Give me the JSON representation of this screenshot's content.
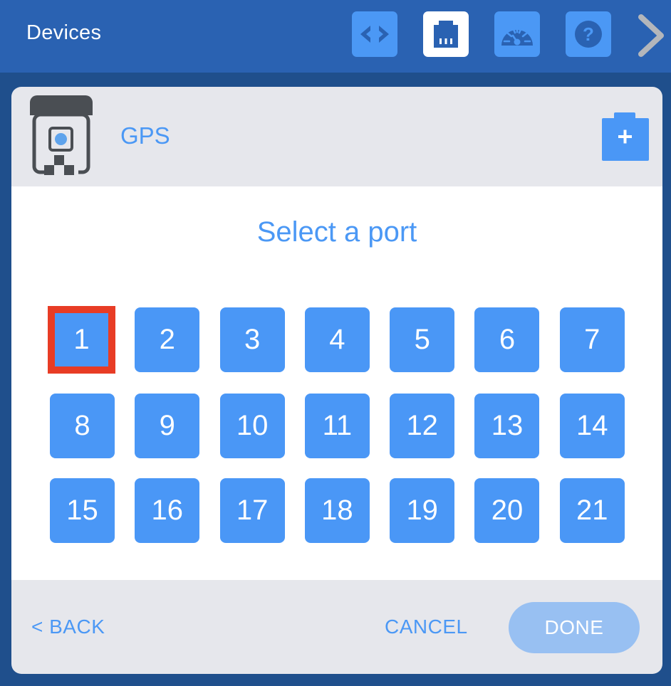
{
  "topbar": {
    "title": "Devices",
    "buttons": [
      {
        "icon": "code-icon",
        "label": "Code",
        "active": false
      },
      {
        "icon": "ports-icon",
        "label": "Devices",
        "active": true
      },
      {
        "icon": "dashboard-icon",
        "label": "Dashboard",
        "active": false
      },
      {
        "icon": "help-icon",
        "label": "Help",
        "active": false
      }
    ],
    "next_icon": "chevron-right-icon"
  },
  "device": {
    "name": "GPS",
    "icon": "gps-sensor-icon",
    "add_icon": "add-device-icon"
  },
  "port_selector": {
    "title": "Select a port",
    "selected_port": "1",
    "ports": [
      "1",
      "2",
      "3",
      "4",
      "5",
      "6",
      "7",
      "8",
      "9",
      "10",
      "11",
      "12",
      "13",
      "14",
      "15",
      "16",
      "17",
      "18",
      "19",
      "20",
      "21"
    ]
  },
  "footer": {
    "back_label": "< BACK",
    "cancel_label": "CANCEL",
    "done_label": "DONE",
    "done_enabled": false
  },
  "colors": {
    "topbar": "#2a62b2",
    "background": "#1f4f8c",
    "accent": "#4b98f5",
    "selected_border": "#e83c25",
    "done_disabled": "#98c0f2"
  }
}
